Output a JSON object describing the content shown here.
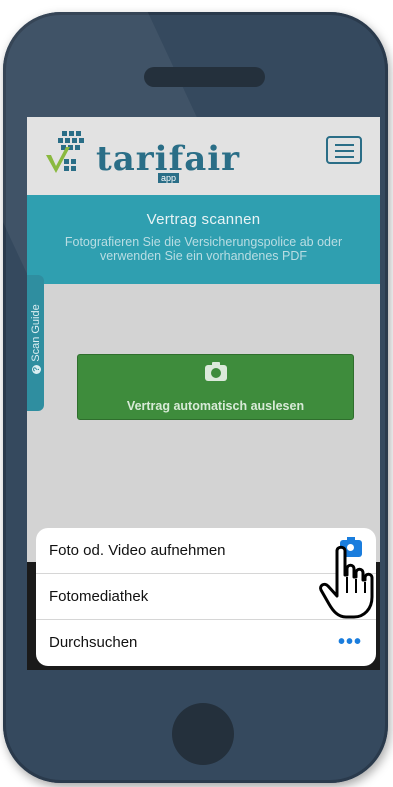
{
  "app": {
    "logo_text": "tarifair",
    "logo_badge": "app"
  },
  "banner": {
    "title": "Vertrag scannen",
    "subtitle": "Fotografieren Sie die Versicherungspolice ab oder verwenden Sie ein vorhandenes PDF"
  },
  "scan_guide": {
    "label": "Scan Guide",
    "icon": "question-circle-icon"
  },
  "main": {
    "auto_read_label": "Vertrag automatisch auslesen",
    "auto_read_icon": "camera-icon"
  },
  "action_sheet": {
    "items": [
      {
        "label": "Foto od. Video aufnehmen",
        "icon": "camera-icon"
      },
      {
        "label": "Fotomediathek",
        "icon": "photo-library-icon"
      },
      {
        "label": "Durchsuchen",
        "icon": "more-dots-icon",
        "glyph": "•••"
      }
    ]
  },
  "colors": {
    "brand": "#2a6e87",
    "banner": "#2f9fb0",
    "primary_button": "#3e8c3c",
    "ios_accent": "#1a7ddd",
    "phone_body": "#35495e"
  }
}
